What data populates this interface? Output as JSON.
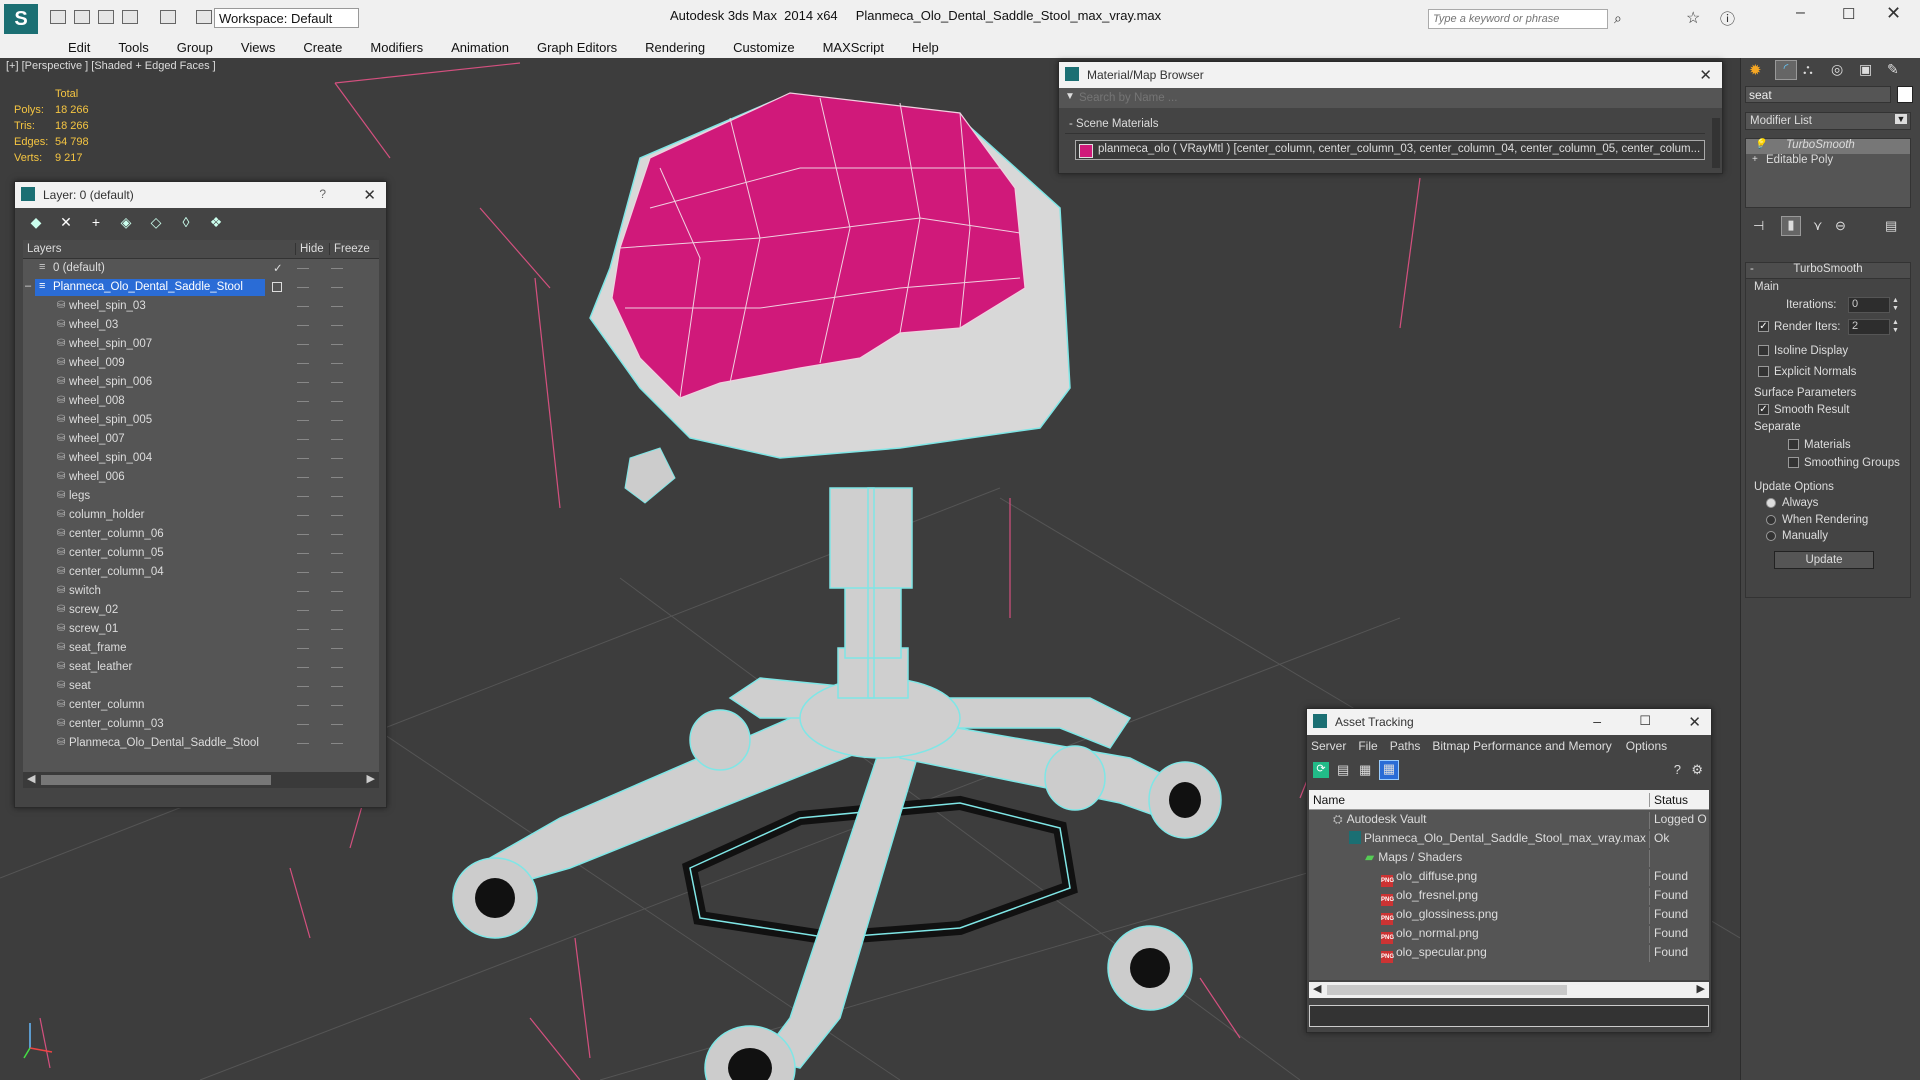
{
  "app": {
    "title": "Autodesk 3ds Max  2014 x64     Planmeca_Olo_Dental_Saddle_Stool_max_vray.max",
    "workspace": "Workspace: Default",
    "search_placeholder": "Type a keyword or phrase"
  },
  "menu": [
    "Edit",
    "Tools",
    "Group",
    "Views",
    "Create",
    "Modifiers",
    "Animation",
    "Graph Editors",
    "Rendering",
    "Customize",
    "MAXScript",
    "Help"
  ],
  "viewport": {
    "label": "[+] [Perspective ] [Shaded + Edged Faces ]",
    "stats": {
      "total_label": "Total",
      "rows": [
        {
          "k": "Polys:",
          "v": "18 266"
        },
        {
          "k": "Tris:",
          "v": "18 266"
        },
        {
          "k": "Edges:",
          "v": "54 798"
        },
        {
          "k": "Verts:",
          "v": "9 217"
        }
      ]
    }
  },
  "layer_window": {
    "title": "Layer: 0 (default)",
    "help": "?",
    "col_layers": "Layers",
    "col_hide": "Hide",
    "col_freeze": "Freeze",
    "default_layer": "0 (default)",
    "selected_layer": "Planmeca_Olo_Dental_Saddle_Stool",
    "objects": [
      "wheel_spin_03",
      "wheel_03",
      "wheel_spin_007",
      "wheel_009",
      "wheel_spin_006",
      "wheel_008",
      "wheel_spin_005",
      "wheel_007",
      "wheel_spin_004",
      "wheel_006",
      "legs",
      "column_holder",
      "center_column_06",
      "center_column_05",
      "center_column_04",
      "switch",
      "screw_02",
      "screw_01",
      "seat_frame",
      "seat_leather",
      "seat",
      "center_column",
      "center_column_03",
      "Planmeca_Olo_Dental_Saddle_Stool"
    ]
  },
  "material_browser": {
    "title": "Material/Map Browser",
    "search_placeholder": "Search by Name ...",
    "section": "Scene Materials",
    "material": "planmeca_olo  ( VRayMtl )  [center_column, center_column_03, center_column_04, center_column_05, center_colum..."
  },
  "command_panel": {
    "object_name": "seat",
    "modifier_list": "Modifier List",
    "stack": [
      "TurboSmooth",
      "Editable Poly"
    ],
    "rollout_title": "TurboSmooth",
    "main_label": "Main",
    "iterations_label": "Iterations:",
    "iterations_value": "0",
    "render_iters_label": "Render Iters:",
    "render_iters_value": "2",
    "isoline": "Isoline Display",
    "explicit_normals": "Explicit Normals",
    "surface_params": "Surface Parameters",
    "smooth_result": "Smooth Result",
    "separate": "Separate",
    "materials": "Materials",
    "smoothing_groups": "Smoothing Groups",
    "update_options": "Update Options",
    "always": "Always",
    "when_rendering": "When Rendering",
    "manually": "Manually",
    "update_button": "Update"
  },
  "asset_tracking": {
    "title": "Asset Tracking",
    "menu": [
      "Server",
      "File",
      "Paths",
      "Bitmap Performance and Memory",
      "Options"
    ],
    "col_name": "Name",
    "col_status": "Status",
    "rows": [
      {
        "name": "Autodesk Vault",
        "status": "Logged O",
        "indent": 0,
        "kind": "vault"
      },
      {
        "name": "Planmeca_Olo_Dental_Saddle_Stool_max_vray.max",
        "status": "Ok",
        "indent": 1,
        "kind": "max"
      },
      {
        "name": "Maps / Shaders",
        "status": "",
        "indent": 2,
        "kind": "folder"
      },
      {
        "name": "olo_diffuse.png",
        "status": "Found",
        "indent": 3,
        "kind": "png"
      },
      {
        "name": "olo_fresnel.png",
        "status": "Found",
        "indent": 3,
        "kind": "png"
      },
      {
        "name": "olo_glossiness.png",
        "status": "Found",
        "indent": 3,
        "kind": "png"
      },
      {
        "name": "olo_normal.png",
        "status": "Found",
        "indent": 3,
        "kind": "png"
      },
      {
        "name": "olo_specular.png",
        "status": "Found",
        "indent": 3,
        "kind": "png"
      }
    ]
  },
  "colors": {
    "seat": "#d0197a",
    "wire": "#7fe6e6",
    "selected": "#2a6cd6",
    "accent": "#f5c542"
  }
}
